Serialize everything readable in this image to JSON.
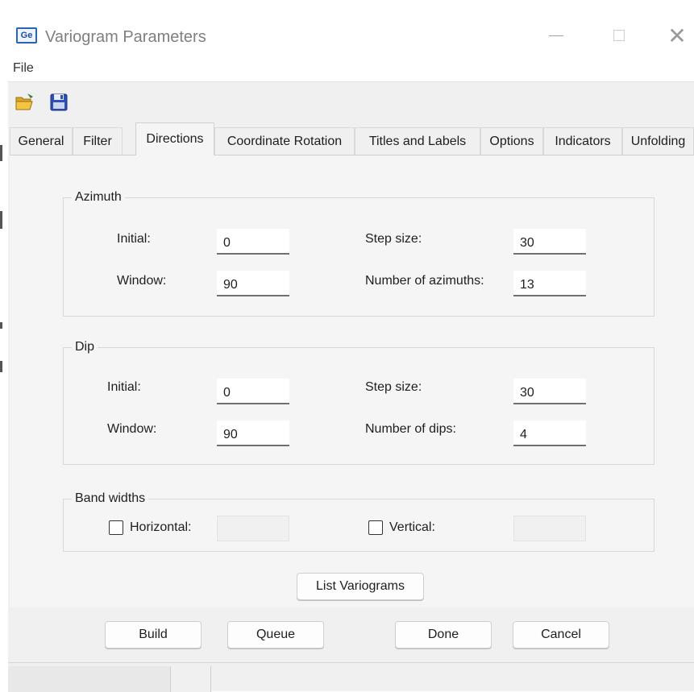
{
  "window": {
    "app_icon": "Ge",
    "title": "Variogram Parameters"
  },
  "menu": {
    "file": "File"
  },
  "toolbar": {
    "open_icon": "open-folder-icon",
    "save_icon": "floppy-save-icon"
  },
  "tabs": [
    {
      "label": "General"
    },
    {
      "label": "Filter"
    },
    {
      "label": "Directions"
    },
    {
      "label": "Coordinate Rotation"
    },
    {
      "label": "Titles and Labels"
    },
    {
      "label": "Options"
    },
    {
      "label": "Indicators"
    },
    {
      "label": "Unfolding"
    }
  ],
  "active_tab": "Directions",
  "azimuth": {
    "legend": "Azimuth",
    "initial_label": "Initial:",
    "initial_value": "0",
    "window_label": "Window:",
    "window_value": "90",
    "step_label": "Step size:",
    "step_value": "30",
    "count_label": "Number of azimuths:",
    "count_value": "13"
  },
  "dip": {
    "legend": "Dip",
    "initial_label": "Initial:",
    "initial_value": "0",
    "window_label": "Window:",
    "window_value": "90",
    "step_label": "Step size:",
    "step_value": "30",
    "count_label": "Number of dips:",
    "count_value": "4"
  },
  "band_widths": {
    "legend": "Band widths",
    "horizontal_label": "Horizontal:",
    "horizontal_checked": false,
    "vertical_label": "Vertical:",
    "vertical_checked": false
  },
  "buttons": {
    "list_variograms": "List Variograms",
    "build": "Build",
    "queue": "Queue",
    "done": "Done",
    "cancel": "Cancel"
  },
  "colors": {
    "window_bg": "#f0f0f0",
    "panel_bg": "#f5f5f5",
    "icon_blue": "#2b63b5"
  }
}
